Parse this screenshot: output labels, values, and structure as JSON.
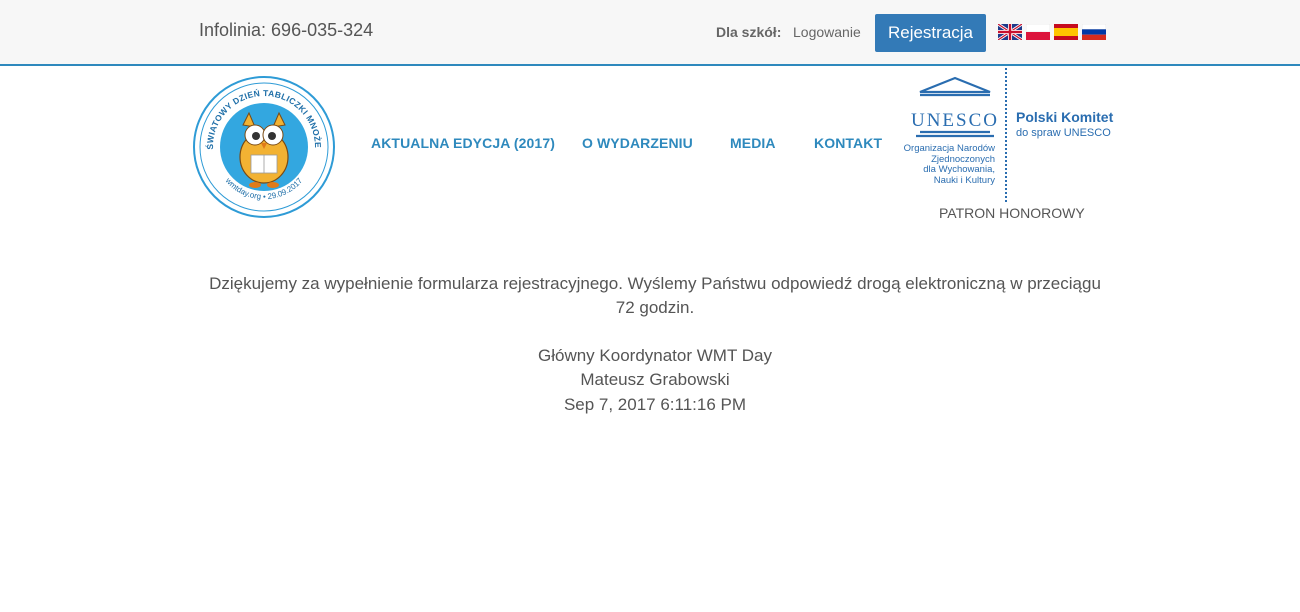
{
  "header": {
    "infoline": "Infolinia: 696-035-324",
    "schools_label": "Dla szkół:",
    "login_label": "Logowanie",
    "register_label": "Rejestracja",
    "flags": [
      "en-flag-icon",
      "pl-flag-icon",
      "es-flag-icon",
      "ru-flag-icon"
    ]
  },
  "logo": {
    "ring_text": "VII ŚWIATOWY DZIEŃ TABLICZKI MNOŻENIA",
    "bottom_text": "wmtday.org • 29.09.2017",
    "icon": "owl-mascot-icon"
  },
  "nav": {
    "items": [
      {
        "label": "AKTUALNA EDYCJA (2017)"
      },
      {
        "label": "O WYDARZENIU"
      },
      {
        "label": "MEDIA"
      },
      {
        "label": "KONTAKT"
      }
    ]
  },
  "unesco": {
    "logo_text": "UNESCO",
    "org_line1": "Organizacja Narodów",
    "org_line2": "Zjednoczonych",
    "org_line3": "dla Wychowania,",
    "org_line4": "Nauki i Kultury",
    "committee_title": "Polski Komitet",
    "committee_sub": "do spraw UNESCO",
    "patron": "PATRON HONOROWY"
  },
  "content": {
    "message": "Dziękujemy za wypełnienie formularza rejestracyjnego. Wyślemy Państwu odpowiedź drogą elektroniczną w przeciągu 72 godzin.",
    "signature_role": "Główny Koordynator WMT Day",
    "signature_name": "Mateusz Grabowski",
    "timestamp": "Sep 7, 2017 6:11:16 PM"
  },
  "colors": {
    "accent": "#2e89bd",
    "button": "#337ab7",
    "unesco_blue": "#2a6db0",
    "text": "#555555"
  }
}
